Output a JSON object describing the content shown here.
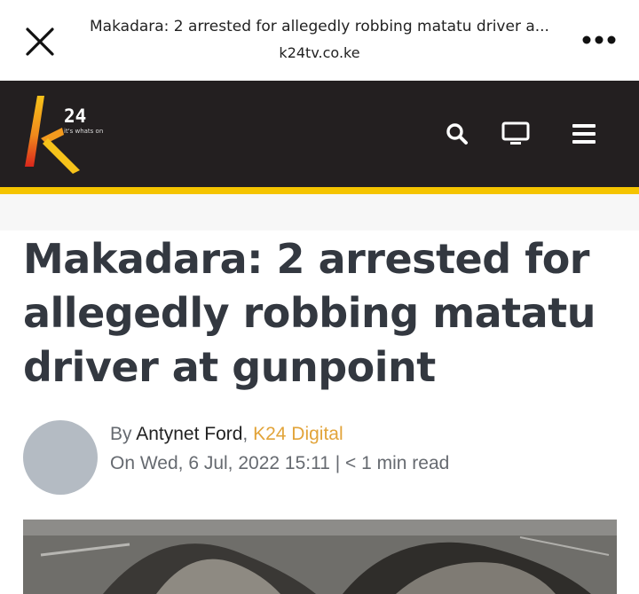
{
  "browser": {
    "title": "Makadara: 2 arrested for allegedly robbing matatu driver a...",
    "url": "k24tv.co.ke",
    "close_icon": "close-icon",
    "more_icon": "more-horizontal-icon"
  },
  "site": {
    "logo_text": "24",
    "tagline": "it's whats on",
    "icons": [
      "search-icon",
      "tv-icon",
      "menu-icon"
    ],
    "colors": {
      "header_bg": "#231f20",
      "accent": "#f5c400",
      "link": "#e2a43a"
    }
  },
  "article": {
    "headline": "Makadara: 2 arrested for allegedly robbing matatu driver at gunpoint",
    "by_prefix": "By ",
    "author": "Antynet Ford",
    "separator": ", ",
    "org": "K24 Digital",
    "date_line": "On Wed, 6 Jul, 2022 15:11 | < 1 min read"
  }
}
